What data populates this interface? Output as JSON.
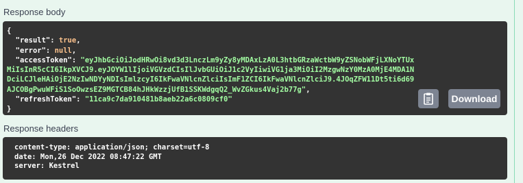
{
  "sections": {
    "body_title": "Response body",
    "headers_title": "Response headers"
  },
  "response_body": {
    "open_brace": "{",
    "close_brace": "}",
    "fields": [
      {
        "key": "\"result\"",
        "value": "true",
        "type": "bool",
        "trail": ","
      },
      {
        "key": "\"error\"",
        "value": "null",
        "type": "nul",
        "trail": ","
      },
      {
        "key": "\"accessToken\"",
        "value": "\"eyJhbGciOiJodHRwOi8vd3d3LnczLm9yZy8yMDAxLzA0L3htbGRzaWctbW9yZSNobWFjLXNoYTUxMiIsInR5cCI6IkpXVCJ9.eyJOYW1lIjoiVGVzdCIsIlJvbGUiOiJ1c2VyIiwiVG1ja3MiOiI2MzgwNzY0MzA0MjE4MDA1NDciLCJleHAiOjE2NzIwNDYyNDIsImlzcyI6IkFwaVNlcnZlciIsImF1ZCI6IkFwaVNlcnZlciJ9.4JOqZFW11Dt5ti6d69AJCOBgPwuWFiS1SoOwzsEZ9MGTCB84hJHkWzzjUfB1SSKWdgqQ2_WvZGkus4Vaj2b77g\"",
        "type": "str",
        "trail": ","
      },
      {
        "key": "\"refreshToken\"",
        "value": "\"11ca9c7da910481b8aeb22a6c0809cf0\"",
        "type": "str",
        "trail": ""
      }
    ]
  },
  "buttons": {
    "copy_icon": "clipboard-icon",
    "download_label": "Download"
  },
  "response_headers": [
    "content-type: application/json; charset=utf-8",
    "date: Mon,26 Dec 2022 08:47:22 GMT",
    "server: Kestrel"
  ],
  "colors": {
    "background": "#e9f6ef",
    "code_bg": "#333333",
    "string": "#a2fca2",
    "literal": "#fcc28c",
    "button": "#7d8492"
  }
}
